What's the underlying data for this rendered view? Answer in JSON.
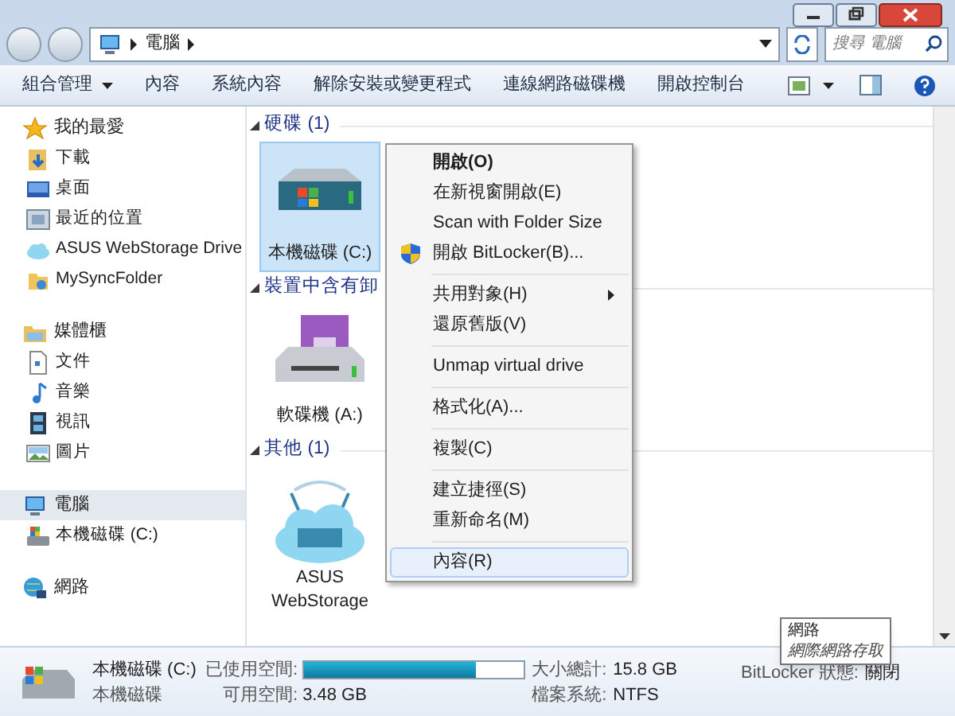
{
  "address": {
    "path": [
      "電腦"
    ],
    "search_placeholder": "搜尋 電腦"
  },
  "toolbar": [
    {
      "label": "組合管理",
      "kind": "menu"
    },
    {
      "label": "內容",
      "kind": "plain"
    },
    {
      "label": "系統內容",
      "kind": "plain"
    },
    {
      "label": "解除安裝或變更程式",
      "kind": "plain"
    },
    {
      "label": "連線網路磁碟機",
      "kind": "plain"
    },
    {
      "label": "開啟控制台",
      "kind": "plain"
    }
  ],
  "sidebar": [
    {
      "label": "我的最愛",
      "selected": false,
      "children": [
        {
          "label": "下載",
          "selected": false
        },
        {
          "label": "桌面",
          "selected": false
        },
        {
          "label": "最近的位置",
          "selected": false
        },
        {
          "label": "ASUS WebStorage Drive",
          "selected": false
        },
        {
          "label": "MySyncFolder",
          "selected": false
        }
      ]
    },
    {
      "label": "媒體櫃",
      "selected": false,
      "children": [
        {
          "label": "文件",
          "selected": false
        },
        {
          "label": "音樂",
          "selected": false
        },
        {
          "label": "視訊",
          "selected": false
        },
        {
          "label": "圖片",
          "selected": false
        }
      ]
    },
    {
      "label": "電腦",
      "selected": true,
      "children": [
        {
          "label": "本機磁碟 (C:)",
          "selected": false
        }
      ]
    },
    {
      "label": "網路",
      "selected": false
    }
  ],
  "sections": [
    {
      "title": "硬碟 (1)",
      "items": [
        {
          "label": "本機磁碟 (C:)",
          "kind": "harddisk",
          "selected": true
        }
      ]
    },
    {
      "title": "裝置中含有卸",
      "items": [
        {
          "label": "軟碟機 (A:)",
          "kind": "floppy",
          "selected": false
        }
      ]
    },
    {
      "title": "其他 (1)",
      "items": [
        {
          "label": "ASUS WebStorage",
          "kind": "cloud",
          "selected": false
        }
      ]
    }
  ],
  "context_menu": [
    [
      {
        "label": "開啟(O)",
        "kind": "default",
        "selected": false
      },
      {
        "label": "在新視窗開啟(E)",
        "kind": "plain",
        "selected": false
      },
      {
        "label": "Scan with Folder Size",
        "kind": "plain",
        "selected": false
      },
      {
        "label": "開啟 BitLocker(B)...",
        "kind": "shield",
        "selected": false
      }
    ],
    [
      {
        "label": "共用對象(H)",
        "kind": "submenu",
        "selected": false
      },
      {
        "label": "還原舊版(V)",
        "kind": "plain",
        "selected": false
      }
    ],
    [
      {
        "label": "Unmap virtual drive",
        "kind": "plain",
        "selected": false
      }
    ],
    [
      {
        "label": "格式化(A)...",
        "kind": "plain",
        "selected": false
      }
    ],
    [
      {
        "label": "複製(C)",
        "kind": "plain",
        "selected": false
      }
    ],
    [
      {
        "label": "建立捷徑(S)",
        "kind": "plain",
        "selected": false
      },
      {
        "label": "重新命名(M)",
        "kind": "plain",
        "selected": false
      }
    ],
    [
      {
        "label": "內容(R)",
        "kind": "plain",
        "selected": true
      }
    ]
  ],
  "details": {
    "name": "本機磁碟 (C:)",
    "type": "本機磁碟",
    "used_label": "已使用空間:",
    "level": 0.78,
    "free_label": "可用空間:",
    "free_value": "3.48 GB",
    "total_label": "大小總計:",
    "total_value": "15.8 GB",
    "fs_label": "檔案系統:",
    "fs_value": "NTFS",
    "bitlocker_label": "BitLocker 狀態:",
    "bitlocker_value": "關閉"
  },
  "tooltip": {
    "title": "網路",
    "subtitle": "網際網路存取"
  }
}
